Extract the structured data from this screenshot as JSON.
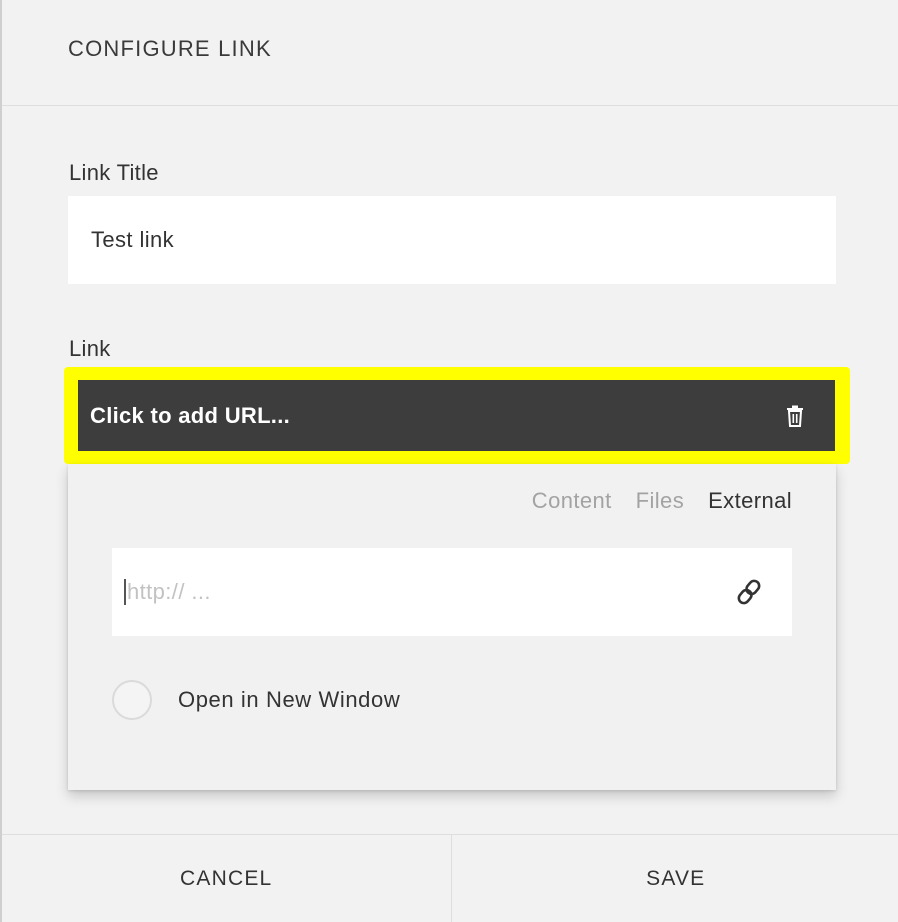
{
  "dialog": {
    "title": "CONFIGURE LINK"
  },
  "form": {
    "link_title_label": "Link Title",
    "link_title_value": "Test link",
    "link_label": "Link",
    "url_button_text": "Click to add URL..."
  },
  "popover": {
    "tabs": [
      {
        "label": "Content",
        "active": false
      },
      {
        "label": "Files",
        "active": false
      },
      {
        "label": "External",
        "active": true
      }
    ],
    "url_placeholder": "http:// ...",
    "new_window_label": "Open in New Window",
    "new_window_checked": false
  },
  "footer": {
    "cancel_label": "CANCEL",
    "save_label": "SAVE"
  },
  "colors": {
    "highlight": "#ffff00",
    "url_bar_bg": "#3d3d3d",
    "dialog_bg": "#f2f2f2"
  },
  "icons": {
    "delete": "trash-icon",
    "link": "chain-link-icon"
  }
}
